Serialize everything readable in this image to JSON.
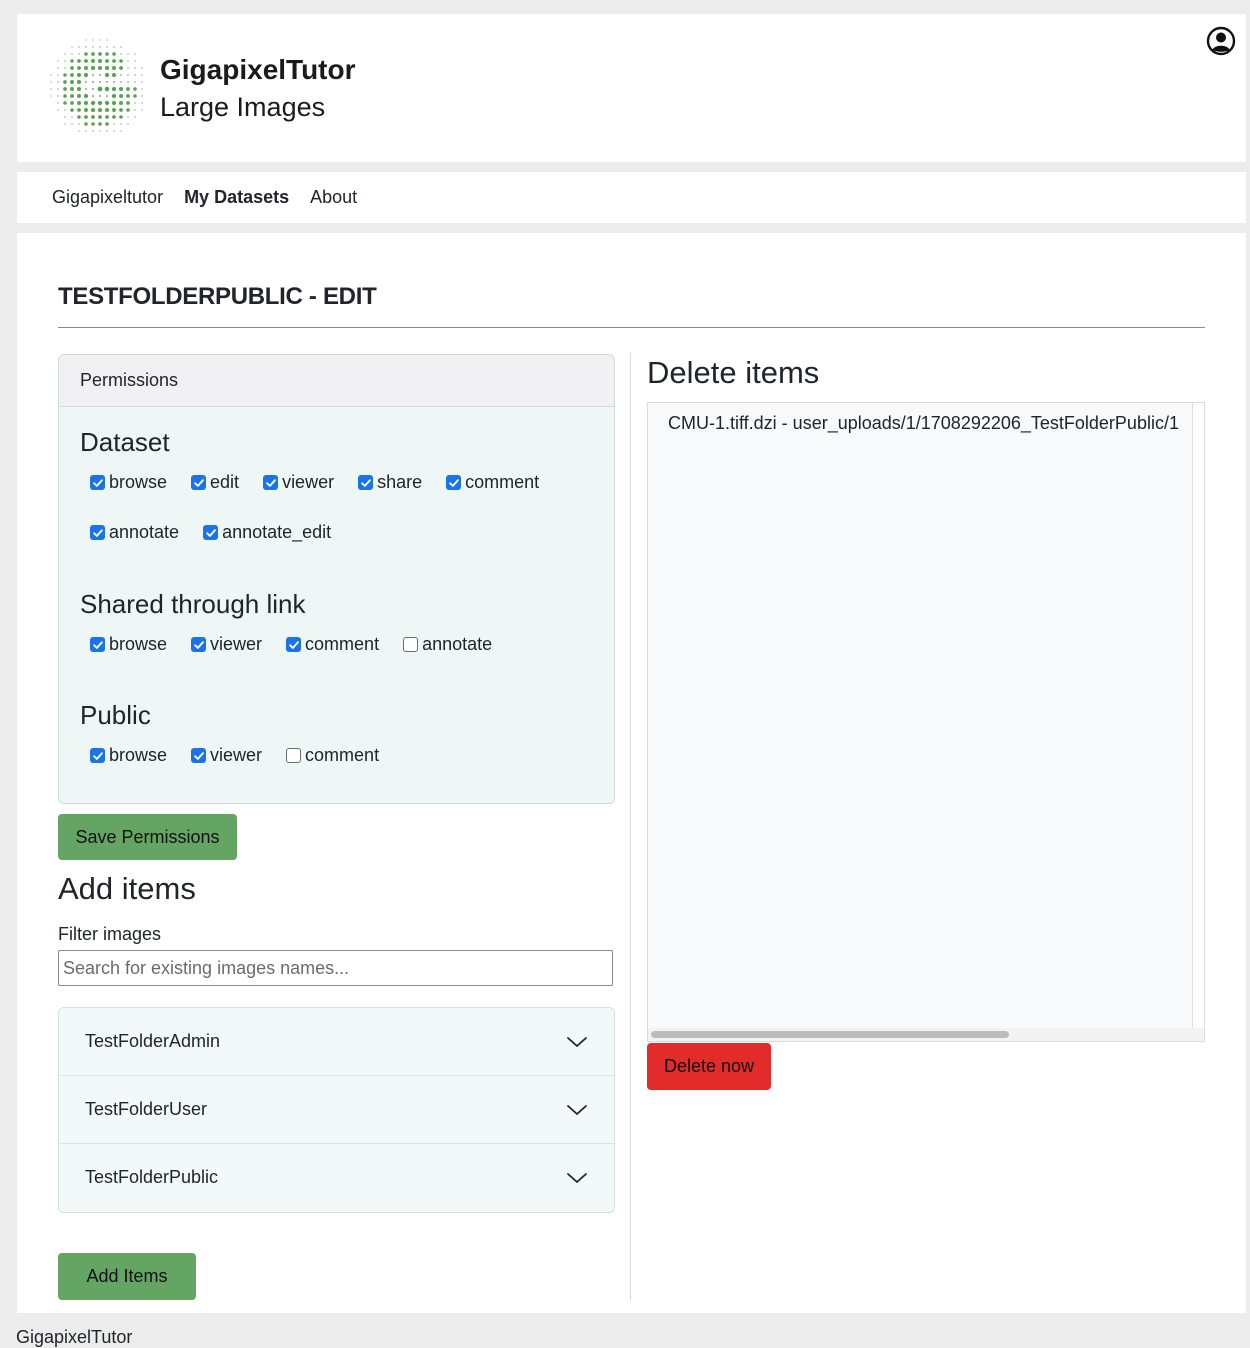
{
  "brand": {
    "title": "GigapixelTutor",
    "subtitle": "Large Images"
  },
  "nav": {
    "items": [
      {
        "label": "Gigapixeltutor",
        "active": false
      },
      {
        "label": "My Datasets",
        "active": true
      },
      {
        "label": "About",
        "active": false
      }
    ]
  },
  "page": {
    "title": "TESTFOLDERPUBLIC - EDIT"
  },
  "permissions": {
    "header": "Permissions",
    "dataset": {
      "title": "Dataset",
      "options": [
        {
          "label": "browse",
          "checked": true
        },
        {
          "label": "edit",
          "checked": true
        },
        {
          "label": "viewer",
          "checked": true
        },
        {
          "label": "share",
          "checked": true
        },
        {
          "label": "comment",
          "checked": true
        },
        {
          "label": "annotate",
          "checked": true
        },
        {
          "label": "annotate_edit",
          "checked": true
        }
      ]
    },
    "shared": {
      "title": "Shared through link",
      "options": [
        {
          "label": "browse",
          "checked": true
        },
        {
          "label": "viewer",
          "checked": true
        },
        {
          "label": "comment",
          "checked": true
        },
        {
          "label": "annotate",
          "checked": false
        }
      ]
    },
    "public": {
      "title": "Public",
      "options": [
        {
          "label": "browse",
          "checked": true
        },
        {
          "label": "viewer",
          "checked": true
        },
        {
          "label": "comment",
          "checked": false
        }
      ]
    },
    "save_label": "Save Permissions"
  },
  "add_items": {
    "title": "Add items",
    "filter_label": "Filter images",
    "filter_placeholder": "Search for existing images names...",
    "filter_value": "",
    "folders": [
      "TestFolderAdmin",
      "TestFolderUser",
      "TestFolderPublic"
    ],
    "add_label": "Add Items"
  },
  "delete_items": {
    "title": "Delete items",
    "items": [
      "CMU-1.tiff.dzi - user_uploads/1/1708292206_TestFolderPublic/1"
    ],
    "delete_label": "Delete now"
  },
  "footer": {
    "text": "GigapixelTutor"
  },
  "colors": {
    "green_button": "#65a563",
    "red_button": "#e22b2b",
    "checkbox_blue": "#1a73e8",
    "logo_green": "#5aa152"
  }
}
